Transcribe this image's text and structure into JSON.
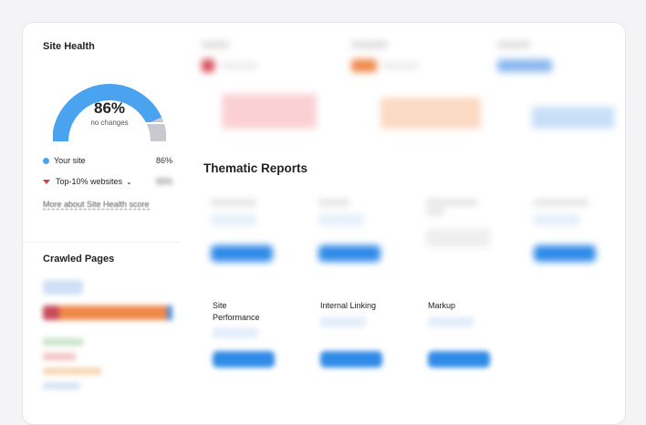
{
  "site_health": {
    "title": "Site Health",
    "value": "86%",
    "value_fraction": 0.86,
    "subtitle": "no changes",
    "legend": [
      {
        "label": "Your site",
        "value": "86%"
      },
      {
        "label": "Top-10% websites",
        "value": "92%"
      }
    ],
    "more_link": "More about Site Health score"
  },
  "crawled_pages": {
    "title": "Crawled Pages"
  },
  "thematic": {
    "title": "Thematic Reports",
    "reports": [
      {
        "label": "Site Performance"
      },
      {
        "label": "Internal Linking"
      },
      {
        "label": "Markup"
      }
    ]
  },
  "colors": {
    "accent": "#4aa3ef",
    "button": "#2f8ae8",
    "errors": "#e05a5a",
    "warnings": "#f0884a",
    "notices": "#4a90e2"
  }
}
